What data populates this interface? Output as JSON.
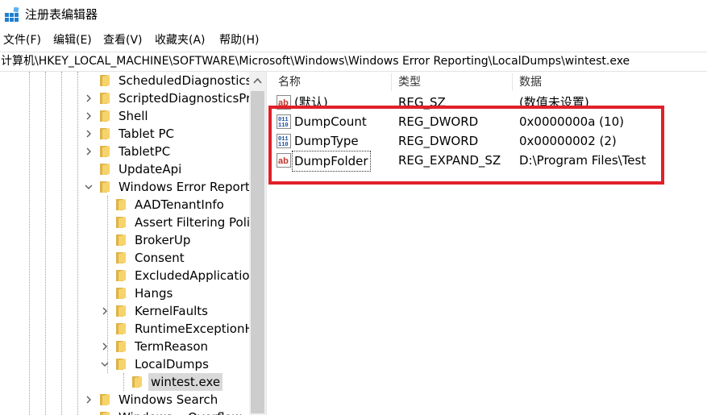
{
  "window": {
    "title": "注册表编辑器",
    "icon": "registry-editor-icon"
  },
  "menu": [
    "文件(F)",
    "编辑(E)",
    "查看(V)",
    "收藏夹(A)",
    "帮助(H)"
  ],
  "address": "计算机\\HKEY_LOCAL_MACHINE\\SOFTWARE\\Microsoft\\Windows\\Windows Error Reporting\\LocalDumps\\wintest.exe",
  "tree": [
    {
      "label": "ScheduledDiagnostics",
      "expander": "none"
    },
    {
      "label": "ScriptedDiagnosticsPr",
      "expander": "collapsed"
    },
    {
      "label": "Shell",
      "expander": "collapsed"
    },
    {
      "label": "Tablet PC",
      "expander": "collapsed"
    },
    {
      "label": "TabletPC",
      "expander": "collapsed"
    },
    {
      "label": "UpdateApi",
      "expander": "none"
    },
    {
      "label": "Windows Error Report",
      "expander": "expanded"
    },
    {
      "label": "AADTenantInfo",
      "expander": "none"
    },
    {
      "label": "Assert Filtering Poli",
      "expander": "none"
    },
    {
      "label": "BrokerUp",
      "expander": "none"
    },
    {
      "label": "Consent",
      "expander": "none"
    },
    {
      "label": "ExcludedApplicatio",
      "expander": "none"
    },
    {
      "label": "Hangs",
      "expander": "none"
    },
    {
      "label": "KernelFaults",
      "expander": "collapsed"
    },
    {
      "label": "RuntimeExceptionH",
      "expander": "none"
    },
    {
      "label": "TermReason",
      "expander": "collapsed"
    },
    {
      "label": "LocalDumps",
      "expander": "expanded"
    },
    {
      "label": "wintest.exe",
      "expander": "none",
      "selected": true
    },
    {
      "label": "Windows Search",
      "expander": "collapsed"
    },
    {
      "label": "Windows... Overflow",
      "expander": "none"
    }
  ],
  "list": {
    "columns": {
      "name": "名称",
      "type": "类型",
      "data": "数据"
    },
    "rows": [
      {
        "name": "(默认)",
        "type": "REG_SZ",
        "data": "(数值未设置)",
        "icon": "string-value-icon"
      },
      {
        "name": "DumpCount",
        "type": "REG_DWORD",
        "data": "0x0000000a (10)",
        "icon": "binary-value-icon"
      },
      {
        "name": "DumpType",
        "type": "REG_DWORD",
        "data": "0x00000002 (2)",
        "icon": "binary-value-icon"
      },
      {
        "name": "DumpFolder",
        "type": "REG_EXPAND_SZ",
        "data": "D:\\Program Files\\Test",
        "icon": "string-value-icon",
        "focused": true
      }
    ]
  },
  "annotation": {
    "color": "#e0202a"
  }
}
